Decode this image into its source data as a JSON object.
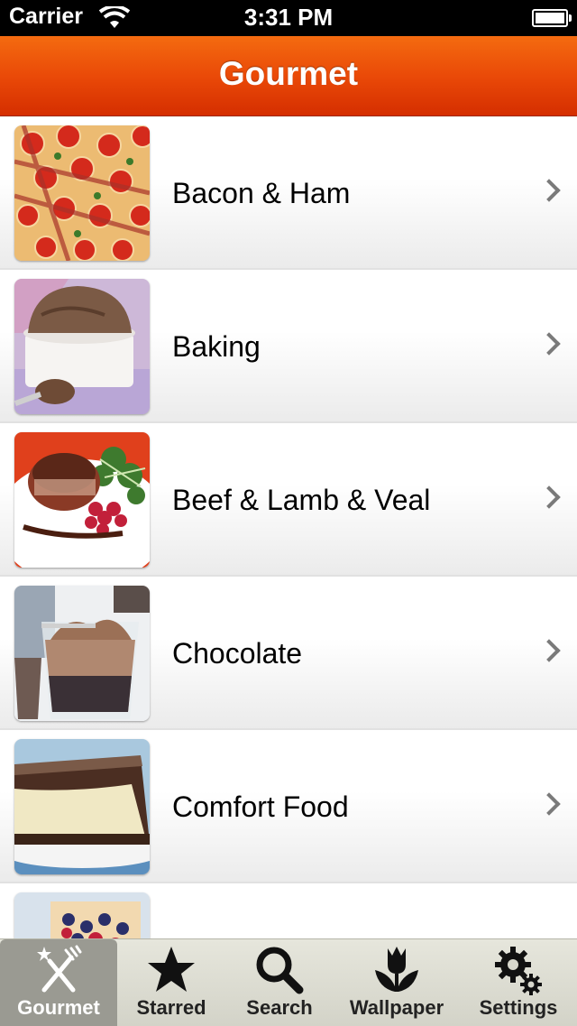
{
  "status_bar": {
    "carrier": "Carrier",
    "time": "3:31 PM"
  },
  "nav": {
    "title": "Gourmet"
  },
  "list": {
    "items": [
      {
        "label": "Bacon & Ham",
        "image": "pizza-photo"
      },
      {
        "label": "Baking",
        "image": "souffle-photo"
      },
      {
        "label": "Beef & Lamb & Veal",
        "image": "steak-photo"
      },
      {
        "label": "Chocolate",
        "image": "chocolate-mousse-photo"
      },
      {
        "label": "Comfort Food",
        "image": "cheesecake-photo"
      },
      {
        "label": "",
        "image": "berry-tart-photo"
      }
    ]
  },
  "tab_bar": {
    "selected": "Gourmet",
    "tabs": [
      {
        "label": "Gourmet",
        "icon": "fork-knife-icon"
      },
      {
        "label": "Starred",
        "icon": "star-icon"
      },
      {
        "label": "Search",
        "icon": "search-icon"
      },
      {
        "label": "Wallpaper",
        "icon": "tulip-icon"
      },
      {
        "label": "Settings",
        "icon": "gears-icon"
      }
    ]
  },
  "colors": {
    "nav_orange": "#ea4a08",
    "tab_selected": "#9a9a92"
  }
}
